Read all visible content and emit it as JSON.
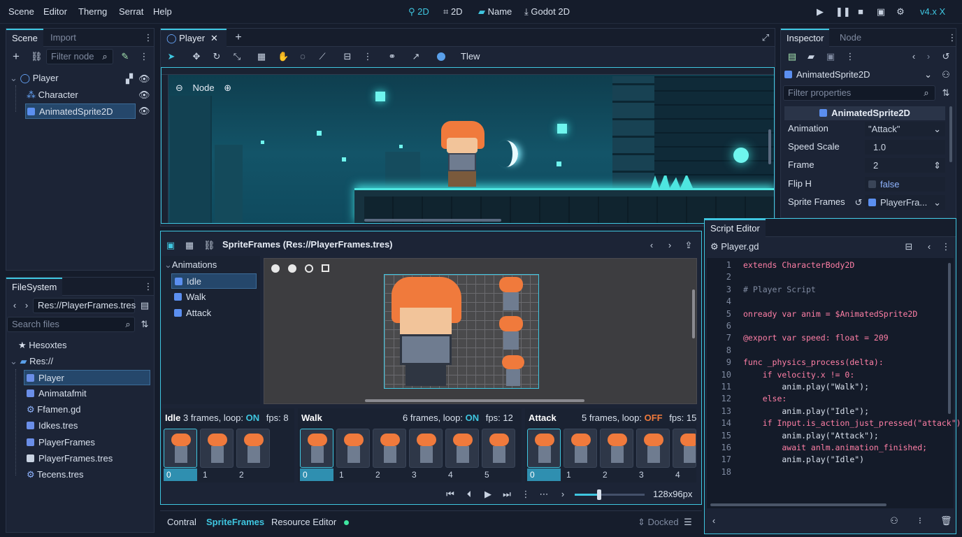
{
  "colors": {
    "accent": "#3fc6e0",
    "bg": "#151c2b",
    "panel": "#1c2436",
    "on": "#3fc6e0",
    "off": "#f07a3c",
    "selection": "#25476b"
  },
  "menu": {
    "items": [
      "Scene",
      "Editor",
      "Therng",
      "Serrat",
      "Help"
    ]
  },
  "toolbar": {
    "mode2d_a": "2D",
    "mode2d_b": "2D",
    "name": "Name",
    "engine": "Godot 2D",
    "version": "v4.x X"
  },
  "scene_dock": {
    "tabs": [
      "Scene",
      "Import"
    ],
    "filter_placeholder": "Filter node",
    "tree": [
      {
        "label": "Player",
        "icon": "node2d-icon"
      },
      {
        "label": "Character",
        "icon": "grid-icon"
      },
      {
        "label": "AnimatedSprite2D",
        "icon": "sprite-icon"
      }
    ]
  },
  "filesystem": {
    "tab": "FileSystem",
    "path": "Res://PlayerFrames.tres",
    "search_placeholder": "Search files",
    "items": [
      {
        "label": "Hesoxtes",
        "icon": "star-icon"
      },
      {
        "label": "Res://",
        "icon": "folder-icon"
      },
      {
        "label": "Player",
        "icon": "scene-icon"
      },
      {
        "label": "Animatafmit",
        "icon": "sprite-icon"
      },
      {
        "label": "Ffamen.gd",
        "icon": "gear-icon"
      },
      {
        "label": "Idkes.tres",
        "icon": "resource-icon"
      },
      {
        "label": "PlayerFrames",
        "icon": "scene-icon"
      },
      {
        "label": "PlayerFrames.tres",
        "icon": "save-icon"
      },
      {
        "label": "Tecens.tres",
        "icon": "gear-icon"
      }
    ]
  },
  "viewport": {
    "tab": "Player",
    "overlay_label": "Node",
    "tool_label": "Tlew"
  },
  "spriteframes": {
    "title": "SpriteFrames (Res://PlayerFrames.tres)",
    "section": "Animations",
    "animations": [
      "Idle",
      "Walk",
      "Attack"
    ],
    "strips": [
      {
        "name": "Idle",
        "frames_text": "3 frames, loop:",
        "loop": "ON",
        "fps_text": "fps:",
        "fps": "8",
        "labels": [
          "0",
          "1",
          "2"
        ]
      },
      {
        "name": "Walk",
        "frames_text": "6 frames, loop:",
        "loop": "ON",
        "fps_text": "fps:",
        "fps": "12",
        "labels": [
          "0",
          "1",
          "2",
          "3",
          "4",
          "5"
        ]
      },
      {
        "name": "Attack",
        "frames_text": "5 frames, loop:",
        "loop": "OFF",
        "fps_text": "fps:",
        "fps": "15",
        "labels": [
          "0",
          "1",
          "2",
          "3",
          "4"
        ]
      }
    ],
    "size": "128x96px",
    "speed_fraction": 0.35
  },
  "bottom_bar": {
    "tabs": [
      "Contral",
      "SpriteFrames",
      "Resource Editor"
    ],
    "docked": "Docked"
  },
  "inspector": {
    "tabs": [
      "Inspector",
      "Node"
    ],
    "node_type": "AnimatedSprite2D",
    "filter_placeholder": "Filter properties",
    "section": "AnimatedSprite2D",
    "props": [
      {
        "label": "Animation",
        "value": "\"Attack\""
      },
      {
        "label": "Speed Scale",
        "value": "1.0"
      },
      {
        "label": "Frame",
        "value": "2"
      },
      {
        "label": "Flip H",
        "value": "false"
      },
      {
        "label": "Sprite Frames",
        "value": "PlayerFra..."
      }
    ]
  },
  "script_editor": {
    "tab": "Script Editor",
    "file": "Player.gd",
    "line_numbers": [
      "1",
      "2",
      "3",
      "4",
      "5",
      "6",
      "7",
      "8",
      "9",
      "10",
      "11",
      "12",
      "13",
      "14",
      "15",
      "16",
      "17",
      "18"
    ],
    "lines": [
      "extends CharacterBody2D",
      "",
      "# Player Script",
      "",
      "onready var anim = $AnimatedSprite2D",
      "",
      "@export var speed: float = 209",
      "",
      "func _physics_process(delta):",
      "    if velocity.x != 0:",
      "        anim.play(\"Walk\");",
      "    else:",
      "        anim.play(\"Idle\");",
      "    if Input.is_action_just_pressed(\"attack\"):",
      "        anim.play(\"Attack\");",
      "        await anlm.animation_finished;",
      "        anim.play(\"Idle\")",
      ""
    ]
  }
}
